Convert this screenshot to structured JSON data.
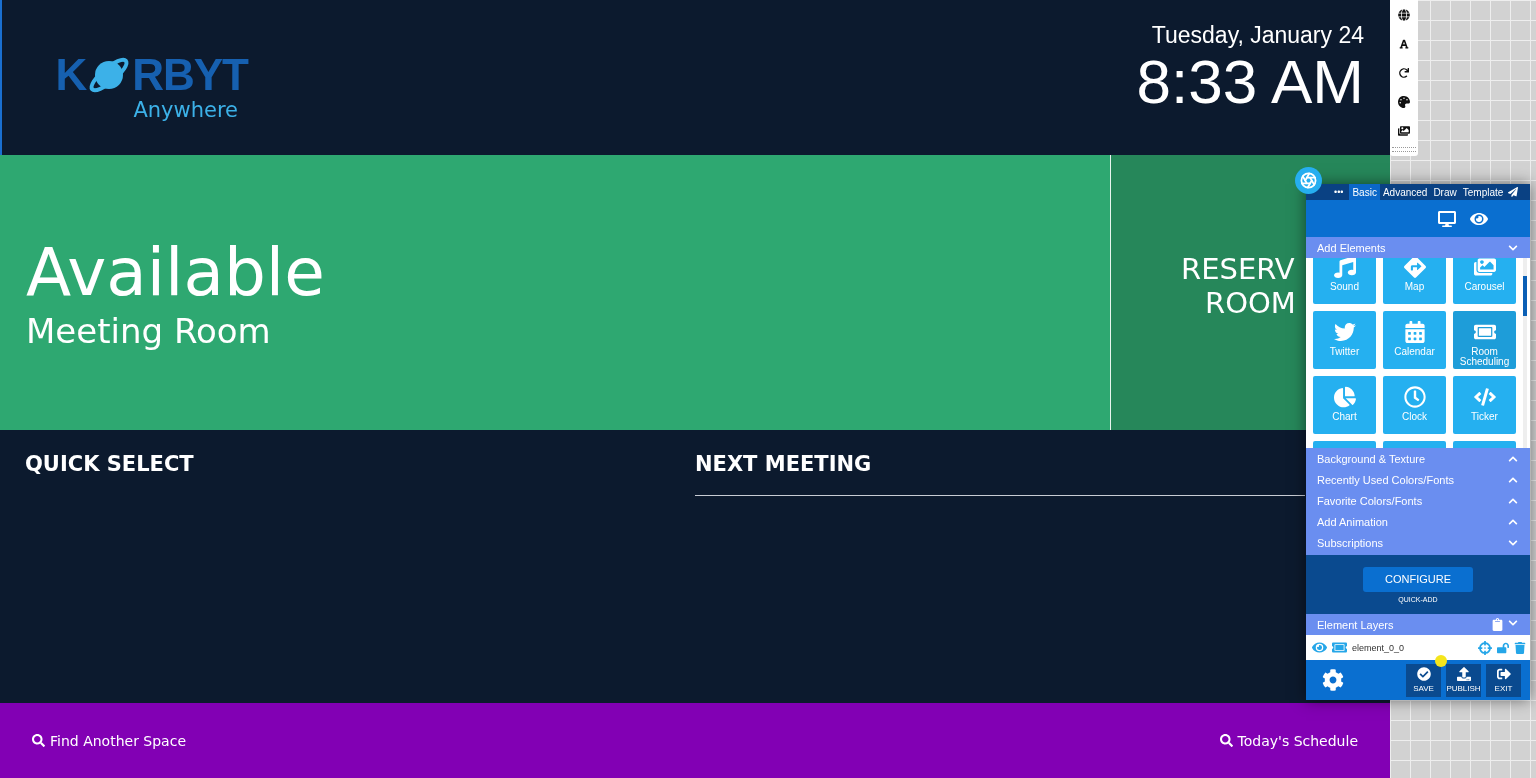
{
  "logo": {
    "lead": "K",
    "rest": "RBYT",
    "tagline": "Anywhere"
  },
  "date": "Tuesday, January 24",
  "time": "8:33 AM",
  "status": {
    "title": "Available",
    "subtitle": "Meeting Room"
  },
  "reserve": [
    "RESERV",
    "ROOM"
  ],
  "quick_select": {
    "title": "QUICK SELECT"
  },
  "next_meeting": {
    "title": "NEXT MEETING"
  },
  "footer_links": [
    {
      "label": "Find Another Space"
    },
    {
      "label": "Today's Schedule"
    }
  ],
  "editor": {
    "menu": "•••",
    "tabs": [
      {
        "label": "Basic",
        "selected": true
      },
      {
        "label": "Advanced",
        "selected": false
      },
      {
        "label": "Draw",
        "selected": false
      },
      {
        "label": "Template",
        "selected": false
      }
    ],
    "add_elements": {
      "label": "Add Elements",
      "expanded": true
    },
    "tiles": [
      {
        "kind": "sound",
        "label": "Sound",
        "selected": false
      },
      {
        "kind": "map",
        "label": "Map",
        "selected": false
      },
      {
        "kind": "carousel",
        "label": "Carousel",
        "selected": false
      },
      {
        "kind": "twitter",
        "label": "Twitter",
        "selected": false
      },
      {
        "kind": "calendar",
        "label": "Calendar",
        "selected": false
      },
      {
        "kind": "room",
        "label": "Room Scheduling",
        "selected": true
      },
      {
        "kind": "chart",
        "label": "Chart",
        "selected": false
      },
      {
        "kind": "clock",
        "label": "Clock",
        "selected": false
      },
      {
        "kind": "ticker",
        "label": "Ticker",
        "selected": false
      }
    ],
    "sections": [
      {
        "label": "Background & Texture",
        "expanded": false
      },
      {
        "label": "Recently Used Colors/Fonts",
        "expanded": false
      },
      {
        "label": "Favorite Colors/Fonts",
        "expanded": false
      },
      {
        "label": "Add Animation",
        "expanded": false
      },
      {
        "label": "Subscriptions",
        "expanded": true
      }
    ],
    "configure": "CONFIGURE",
    "quick_add": "QUICK-ADD",
    "layers": {
      "label": "Element Layers",
      "items": [
        {
          "name": "element_0_0"
        }
      ]
    },
    "actions": [
      {
        "kind": "save",
        "label": "SAVE"
      },
      {
        "kind": "publish",
        "label": "PUBLISH"
      },
      {
        "kind": "exit",
        "label": "EXIT"
      }
    ]
  }
}
